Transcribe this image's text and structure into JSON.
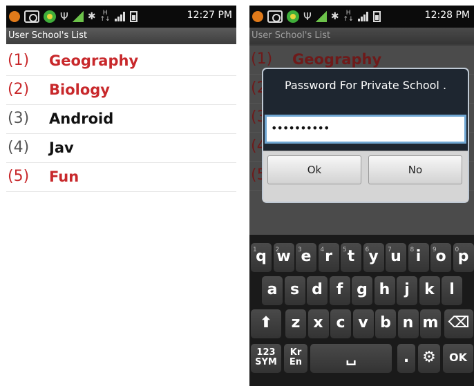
{
  "left_screen": {
    "status_time": "12:27 PM",
    "title": "User School's List",
    "items": [
      {
        "index": "(1)",
        "name": "Geography"
      },
      {
        "index": "(2)",
        "name": "Biology"
      },
      {
        "index": "(3)",
        "name": "Android"
      },
      {
        "index": "(4)",
        "name": "Jav"
      },
      {
        "index": "(5)",
        "name": "Fun"
      }
    ],
    "colors": {
      "private": "#c8282b",
      "public": "#111111"
    }
  },
  "right_screen": {
    "status_time": "12:28 PM",
    "title": "User School's List",
    "items": [
      {
        "index": "(1)",
        "name": "Geography"
      },
      {
        "index": "(2)",
        "name": ""
      },
      {
        "index": "(3)",
        "name": ""
      },
      {
        "index": "(4)",
        "name": ""
      },
      {
        "index": "(5)",
        "name": ""
      }
    ],
    "dialog": {
      "title": "Password For Private School .",
      "password_value": "••••••••••",
      "ok_label": "Ok",
      "no_label": "No"
    },
    "keyboard": {
      "row1": [
        "q",
        "w",
        "e",
        "r",
        "t",
        "y",
        "u",
        "i",
        "o",
        "p"
      ],
      "row1_digits": [
        "1",
        "2",
        "3",
        "4",
        "5",
        "6",
        "7",
        "8",
        "9",
        "0"
      ],
      "row2": [
        "a",
        "s",
        "d",
        "f",
        "g",
        "h",
        "j",
        "k",
        "l"
      ],
      "row3": [
        "z",
        "x",
        "c",
        "v",
        "b",
        "n",
        "m"
      ],
      "shift": "⬆",
      "backspace": "⌫",
      "sym": "123\nSYM",
      "lang": "Kr",
      "lang_sub": "En",
      "space": "␣",
      "period": ".",
      "settings": "⚙",
      "ok": "OK"
    }
  }
}
